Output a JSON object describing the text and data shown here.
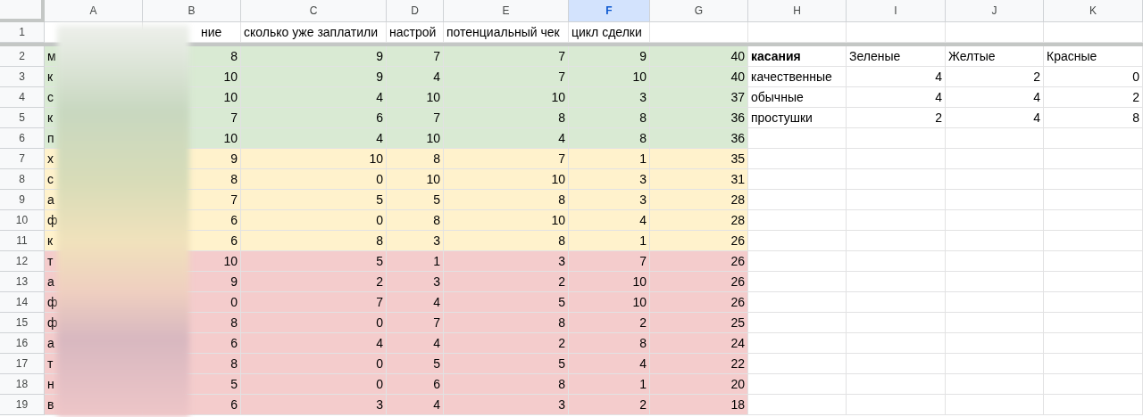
{
  "columns": [
    {
      "letter": "A",
      "selected": false
    },
    {
      "letter": "B",
      "selected": false
    },
    {
      "letter": "C",
      "selected": false
    },
    {
      "letter": "D",
      "selected": false
    },
    {
      "letter": "E",
      "selected": false
    },
    {
      "letter": "F",
      "selected": true
    },
    {
      "letter": "G",
      "selected": false
    },
    {
      "letter": "H",
      "selected": false
    },
    {
      "letter": "I",
      "selected": false
    },
    {
      "letter": "J",
      "selected": false
    },
    {
      "letter": "K",
      "selected": false
    }
  ],
  "rows": [
    {
      "number": "1",
      "kind": "header",
      "cells": [
        null,
        "ние",
        "сколько уже заплатили",
        "настрой",
        "потенциальный чек",
        "цикл сделки",
        null
      ]
    },
    {
      "number": "2",
      "kind": "data",
      "color": "#d9ead3",
      "cells": [
        "м",
        "8",
        "9",
        "7",
        "7",
        "9",
        "40"
      ],
      "side": {
        "kind": "header",
        "cells": [
          "касания",
          "Зеленые",
          "Желтые",
          "Красные"
        ]
      }
    },
    {
      "number": "3",
      "kind": "data",
      "color": "#d9ead3",
      "cells": [
        "к",
        "10",
        "9",
        "4",
        "7",
        "10",
        "40"
      ],
      "side": {
        "kind": "data",
        "cells": [
          "качественные",
          "4",
          "2",
          "0"
        ]
      }
    },
    {
      "number": "4",
      "kind": "data",
      "color": "#d9ead3",
      "cells": [
        "с",
        "10",
        "4",
        "10",
        "10",
        "3",
        "37"
      ],
      "side": {
        "kind": "data",
        "cells": [
          "обычные",
          "4",
          "4",
          "2"
        ]
      }
    },
    {
      "number": "5",
      "kind": "data",
      "color": "#d9ead3",
      "cells": [
        "к",
        "7",
        "6",
        "7",
        "8",
        "8",
        "36"
      ],
      "side": {
        "kind": "data",
        "cells": [
          "простушки",
          "2",
          "4",
          "8"
        ]
      }
    },
    {
      "number": "6",
      "kind": "data",
      "color": "#d9ead3",
      "cells": [
        "п",
        "10",
        "4",
        "10",
        "4",
        "8",
        "36"
      ]
    },
    {
      "number": "7",
      "kind": "data",
      "color": "#fff2cc",
      "cells": [
        "х",
        "9",
        "10",
        "8",
        "7",
        "1",
        "35"
      ]
    },
    {
      "number": "8",
      "kind": "data",
      "color": "#fff2cc",
      "cells": [
        "с",
        "8",
        "0",
        "10",
        "10",
        "3",
        "31"
      ]
    },
    {
      "number": "9",
      "kind": "data",
      "color": "#fff2cc",
      "cells": [
        "а",
        "7",
        "5",
        "5",
        "8",
        "3",
        "28"
      ]
    },
    {
      "number": "10",
      "kind": "data",
      "color": "#fff2cc",
      "cells": [
        "ф",
        "6",
        "0",
        "8",
        "10",
        "4",
        "28"
      ]
    },
    {
      "number": "11",
      "kind": "data",
      "color": "#fff2cc",
      "cells": [
        "к",
        "6",
        "8",
        "3",
        "8",
        "1",
        "26"
      ]
    },
    {
      "number": "12",
      "kind": "data",
      "color": "#f4cccc",
      "cells": [
        "т",
        "10",
        "5",
        "1",
        "3",
        "7",
        "26"
      ]
    },
    {
      "number": "13",
      "kind": "data",
      "color": "#f4cccc",
      "cells": [
        "а",
        "9",
        "2",
        "3",
        "2",
        "10",
        "26"
      ]
    },
    {
      "number": "14",
      "kind": "data",
      "color": "#f4cccc",
      "cells": [
        "ф",
        "0",
        "7",
        "4",
        "5",
        "10",
        "26"
      ]
    },
    {
      "number": "15",
      "kind": "data",
      "color": "#f4cccc",
      "cells": [
        "ф",
        "8",
        "0",
        "7",
        "8",
        "2",
        "25"
      ]
    },
    {
      "number": "16",
      "kind": "data",
      "color": "#f4cccc",
      "cells": [
        "а",
        "6",
        "4",
        "4",
        "2",
        "8",
        "24"
      ]
    },
    {
      "number": "17",
      "kind": "data",
      "color": "#f4cccc",
      "cells": [
        "т",
        "8",
        "0",
        "5",
        "5",
        "4",
        "22"
      ]
    },
    {
      "number": "18",
      "kind": "data",
      "color": "#f4cccc",
      "cells": [
        "н",
        "5",
        "0",
        "6",
        "8",
        "1",
        "20"
      ]
    },
    {
      "number": "19",
      "kind": "data",
      "color": "#f4cccc",
      "cells": [
        "в",
        "6",
        "3",
        "4",
        "3",
        "2",
        "18"
      ]
    }
  ]
}
